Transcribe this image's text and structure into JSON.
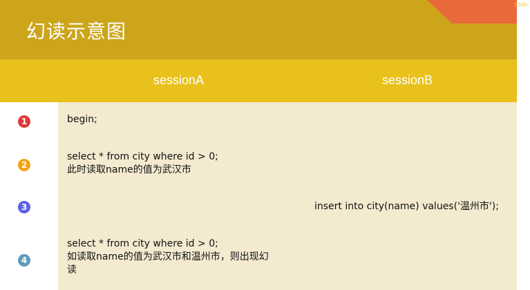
{
  "header": {
    "title": "幻读示意图",
    "corner_text": "XMin"
  },
  "columns": {
    "session_a": "sessionA",
    "session_b": "sessionB"
  },
  "rows": [
    {
      "step": "1",
      "color": "#e0393a",
      "session_a_line1": "begin;",
      "session_a_line2": "",
      "session_a_line3": "",
      "session_b": ""
    },
    {
      "step": "2",
      "color": "#f2a514",
      "session_a_line1": " select * from city where id > 0;",
      "session_a_line2": "此时读取name的值为武汉市",
      "session_a_line3": "",
      "session_b": ""
    },
    {
      "step": "3",
      "color": "#5b63e6",
      "session_a_line1": "",
      "session_a_line2": "",
      "session_a_line3": "",
      "session_b": "insert into city(name) values('温州市');"
    },
    {
      "step": "4",
      "color": "#5e9bbd",
      "session_a_line1": "select * from city where id > 0;",
      "session_a_line2": "如读取name的值为武汉市和温州市，则出现幻",
      "session_a_line3": "读",
      "session_b": ""
    }
  ]
}
